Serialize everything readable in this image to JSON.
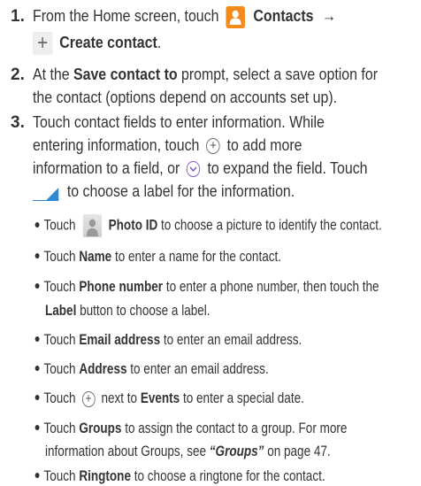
{
  "steps": [
    {
      "num": "1.",
      "l1_a": "From the Home screen, touch",
      "l1_b": "Contacts",
      "l1_arrow": "→",
      "l2": "Create contact",
      "l2_period": "."
    },
    {
      "num": "2.",
      "l1_a": "At the",
      "l1_b": "Save contact to",
      "l1_c": "prompt, select a save option for",
      "l2": "the contact (options depend on accounts set up)."
    },
    {
      "num": "3.",
      "l1": "Touch contact fields to enter information. While",
      "l2": "entering information, touch",
      "l2_b": "to add more",
      "l3_a": "information to a field, or",
      "l3_b": "to expand the field. Touch",
      "l4": "to choose a label for the information."
    }
  ],
  "bullets": [
    {
      "a": "Touch",
      "b": "Photo ID",
      "c": "to choose a picture to identify the contact."
    },
    {
      "a": "Touch",
      "b": "Name",
      "c": "to enter a name for the contact."
    },
    {
      "a": "Touch",
      "b": "Phone number",
      "c": "to enter a phone number, then touch the",
      "d_b": "Label",
      "d": "button to choose a label."
    },
    {
      "a": "Touch",
      "b": "Email address",
      "c": "to enter an email address."
    },
    {
      "a": "Touch",
      "b": "Address",
      "c": "to enter an email address."
    },
    {
      "a": "Touch",
      "b": "Events",
      "pre": "next to",
      "c": "to enter a special date."
    },
    {
      "a": "Touch",
      "b": "Groups",
      "c": "to assign the contact to a group. For more",
      "d": "information about Groups, see",
      "d_i": "“Groups”",
      "d_end": "on page 47."
    },
    {
      "a": "Touch",
      "b": "Ringtone",
      "c": "to choose a ringtone for the contact."
    }
  ],
  "icons": {
    "contacts": "contacts-app-icon",
    "create": "plus-icon",
    "add": "circle-plus-icon",
    "expand": "circle-chevron-down-icon",
    "label": "label-selector-icon",
    "photo": "photo-id-icon"
  },
  "colors": {
    "contacts_icon": "#f28a1c",
    "label_blue": "#2a8ad8",
    "chevron_purple": "#8a58c7"
  }
}
